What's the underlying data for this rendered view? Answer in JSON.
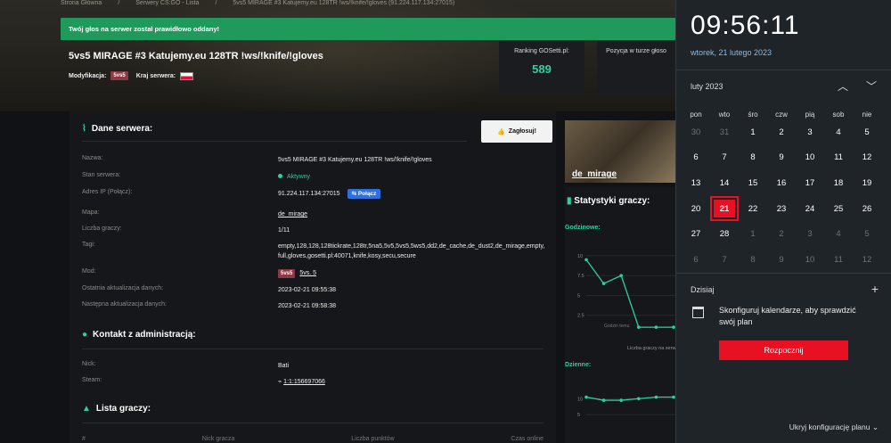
{
  "breadcrumb": [
    "Strona Główna",
    "/",
    "Serwery CS:GO - Lista",
    "/",
    "5vs5 MIRAGE #3 Katujemy.eu 128TR !ws/!knife/!gloves (91.224.117.134:27015)"
  ],
  "alert": "Twój głos na serwer został prawidłowo oddany!",
  "server": {
    "title": "5vs5 MIRAGE #3 Katujemy.eu 128TR !ws/!knife/!gloves",
    "mod_label": "Modyfikacja:",
    "mod_badge": "5vs5",
    "country_label": "Kraj serwera:"
  },
  "stats": {
    "ranking_label": "Ranking GOSetti.pl:",
    "ranking_value": "589",
    "position_label": "Pozycja w turze głoso"
  },
  "details": {
    "heading": "Dane serwera:",
    "vote_button": "Zagłosuj!",
    "rows": [
      {
        "k": "Nazwa:",
        "v": "5vs5 MIRAGE #3 Katujemy.eu 128TR !ws/!knife/!gloves"
      },
      {
        "k": "Stan serwera:",
        "v": "Aktywny"
      },
      {
        "k": "Adres IP (Połącz):",
        "v": "91.224.117.134:27015"
      },
      {
        "k": "Mapa:",
        "v": "de_mirage"
      },
      {
        "k": "Liczba graczy:",
        "v": "1/11"
      },
      {
        "k": "Tagi:",
        "v": "empty,128,128,128tickrate,128tr,5na5,5v5,5vs5,5ws5,dd2,de_cache,de_dust2,de_mirage,empty,full,gloves,gosetti.pl:40071,knife,kosy,secu,secure"
      },
      {
        "k": "Mod:",
        "v": "5vs. 5"
      },
      {
        "k": "Ostatnia aktualizacja danych:",
        "v": "2023-02-21 09:55:38"
      },
      {
        "k": "Następna aktualizacja danych:",
        "v": "2023-02-21 09:58:38"
      }
    ],
    "connect": "Połącz",
    "mod_badge": "5vs5"
  },
  "contact": {
    "heading": "Kontakt z administracją:",
    "rows": [
      {
        "k": "Nick:",
        "v": "Bati"
      },
      {
        "k": "Steam:",
        "v": "1:1:156697066"
      }
    ]
  },
  "players": {
    "heading": "Lista graczy:",
    "cols": [
      "#",
      "Nick gracza",
      "Liczba punktów",
      "Czas online"
    ]
  },
  "map": {
    "name": "de_mirage"
  },
  "playerstats": {
    "heading": "Statystyki graczy:",
    "hourly": "Godzinowe:",
    "daily": "Dzienne:",
    "hourly_caption": "Liczba graczy na serw",
    "tooltip": "Godzin temu",
    "hourly_ticks": [
      "10",
      "7.5",
      "5",
      "2.5"
    ],
    "daily_ticks": [
      "10",
      "5"
    ],
    "hourly_values": [
      9.5,
      6.5,
      7.5,
      1,
      1,
      1
    ],
    "daily_values": [
      10.5,
      9.5,
      9.5,
      10,
      10.5,
      10.5
    ]
  },
  "calendar": {
    "time": "09:56:11",
    "date": "wtorek, 21 lutego 2023",
    "month": "luty 2023",
    "weekdays": [
      "pon",
      "wto",
      "śro",
      "czw",
      "pią",
      "sob",
      "nie"
    ],
    "days": [
      [
        "30",
        "o"
      ],
      [
        "31",
        "o"
      ],
      [
        "1",
        "c"
      ],
      [
        "2",
        "c"
      ],
      [
        "3",
        "c"
      ],
      [
        "4",
        "c"
      ],
      [
        "5",
        "c"
      ],
      [
        "6",
        "c"
      ],
      [
        "7",
        "c"
      ],
      [
        "8",
        "c"
      ],
      [
        "9",
        "c"
      ],
      [
        "10",
        "c"
      ],
      [
        "11",
        "c"
      ],
      [
        "12",
        "c"
      ],
      [
        "13",
        "c"
      ],
      [
        "14",
        "c"
      ],
      [
        "15",
        "c"
      ],
      [
        "16",
        "c"
      ],
      [
        "17",
        "c"
      ],
      [
        "18",
        "c"
      ],
      [
        "19",
        "c"
      ],
      [
        "20",
        "c"
      ],
      [
        "21",
        "t"
      ],
      [
        "22",
        "c"
      ],
      [
        "23",
        "c"
      ],
      [
        "24",
        "c"
      ],
      [
        "25",
        "c"
      ],
      [
        "26",
        "c"
      ],
      [
        "27",
        "c"
      ],
      [
        "28",
        "c"
      ],
      [
        "1",
        "o"
      ],
      [
        "2",
        "o"
      ],
      [
        "3",
        "o"
      ],
      [
        "4",
        "o"
      ],
      [
        "5",
        "o"
      ],
      [
        "6",
        "o"
      ],
      [
        "7",
        "o"
      ],
      [
        "8",
        "o"
      ],
      [
        "9",
        "o"
      ],
      [
        "10",
        "o"
      ],
      [
        "11",
        "o"
      ],
      [
        "12",
        "o"
      ]
    ],
    "today_label": "Dzisiaj",
    "event_text": "Skonfiguruj kalendarze, aby sprawdzić swój plan",
    "start_button": "Rozpocznij",
    "hide_label": "Ukryj konfigurację planu"
  }
}
